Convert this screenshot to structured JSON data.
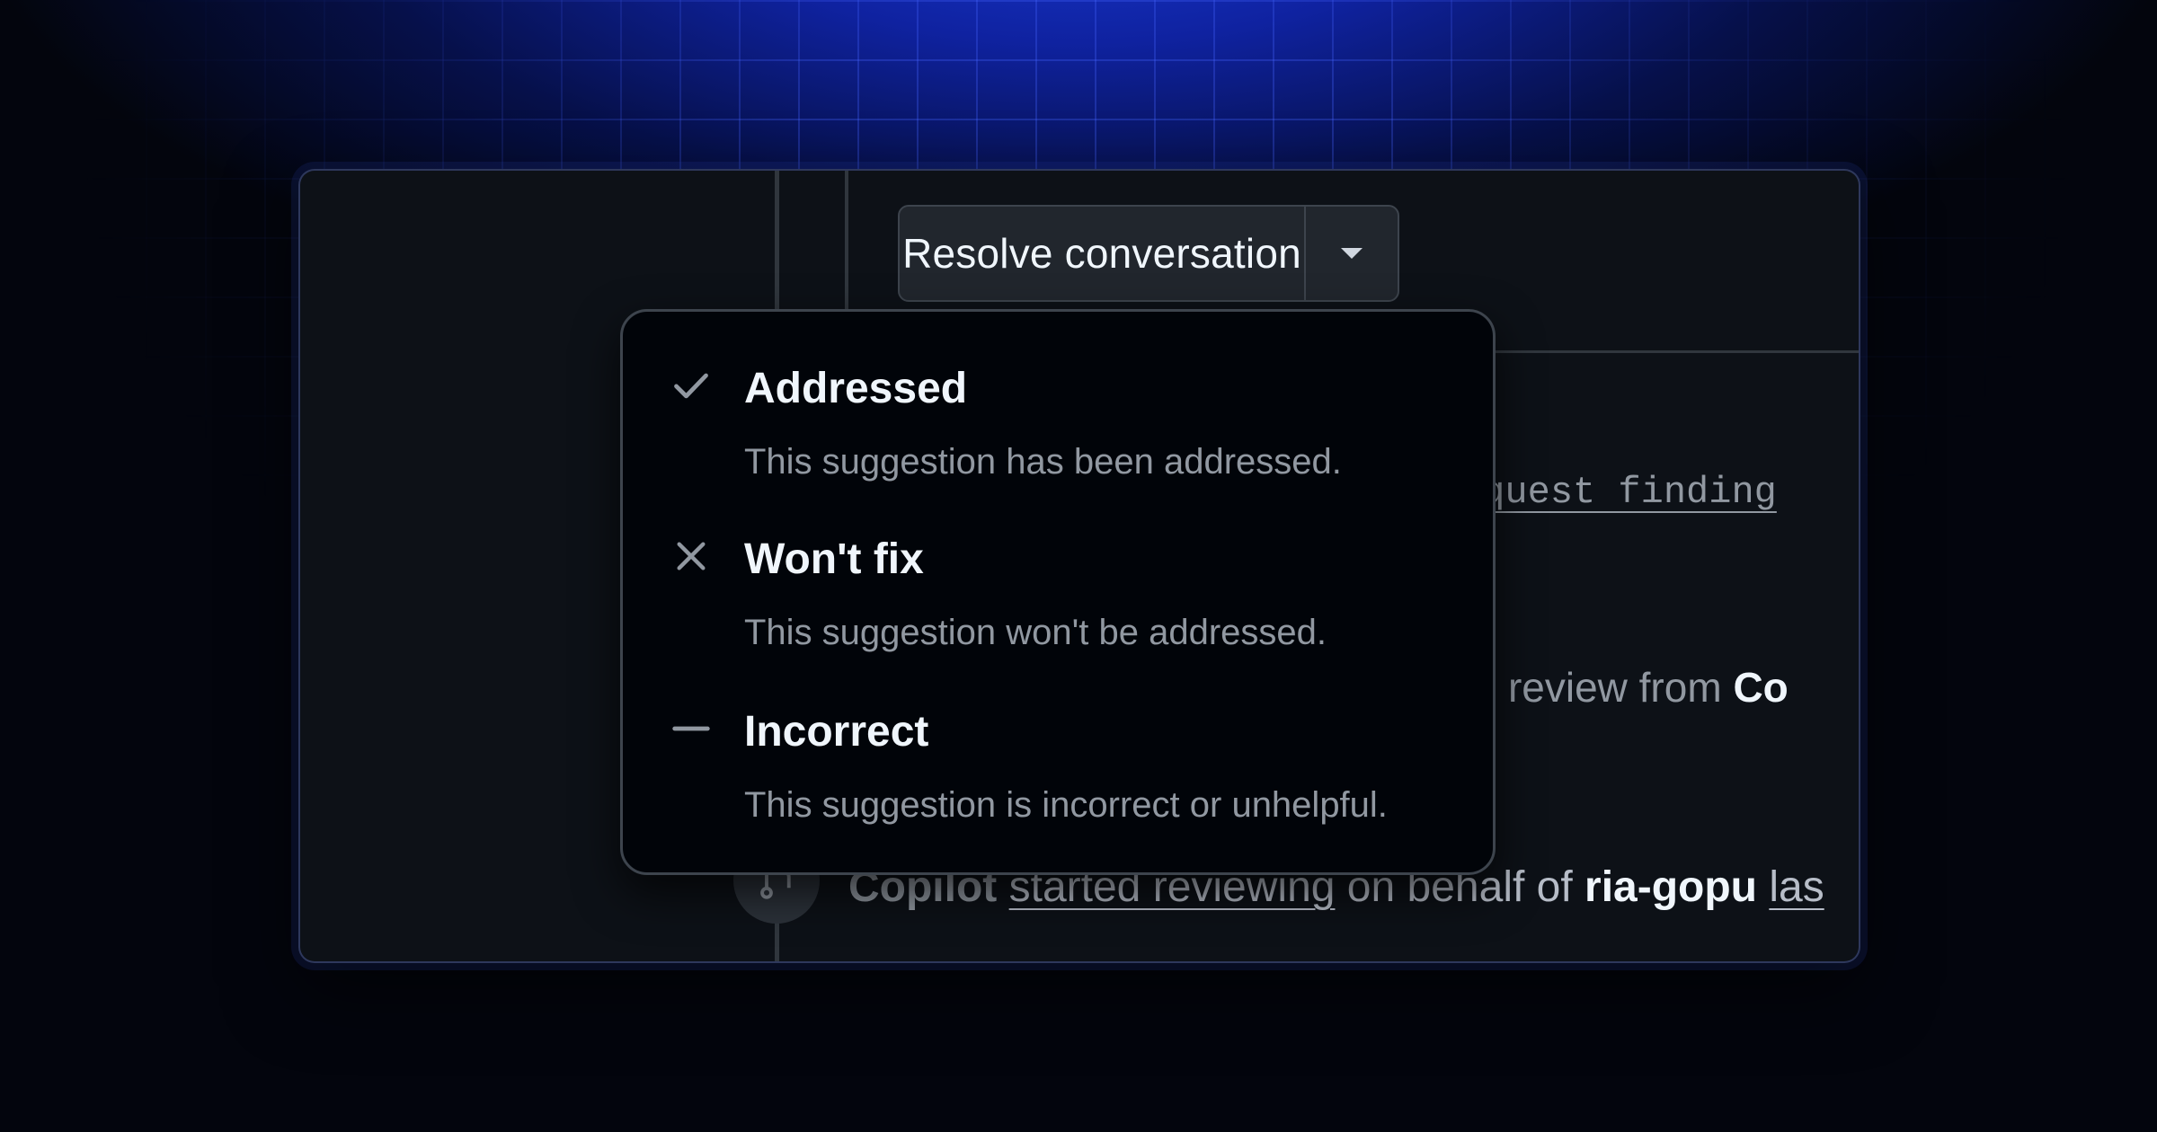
{
  "colors": {
    "page_background": "#03050d",
    "accent_grid": "#2b4bff",
    "panel_background": "#0d1117",
    "menu_background": "#010409",
    "text_primary": "#f0f6fc",
    "text_muted": "#9198a1"
  },
  "resolve": {
    "label": "Resolve conversation",
    "dropdown_icon": "triangle-down-icon"
  },
  "background": {
    "code_link": "equest finding",
    "review_text": "ed review from ",
    "review_actor": "Co",
    "activity": {
      "actor": "Copilot",
      "action": "started reviewing",
      "middle": " on behalf of ",
      "user": "ria-gopu",
      "trailing": "las",
      "icon": "git-pull-request-icon"
    }
  },
  "menu": {
    "items": [
      {
        "label": "Addressed",
        "description": "This suggestion has been addressed.",
        "icon": "check-icon"
      },
      {
        "label": "Won't fix",
        "description": "This suggestion won't be addressed.",
        "icon": "x-icon"
      },
      {
        "label": "Incorrect",
        "description": "This suggestion is incorrect or unhelpful.",
        "icon": "dash-icon"
      }
    ]
  }
}
